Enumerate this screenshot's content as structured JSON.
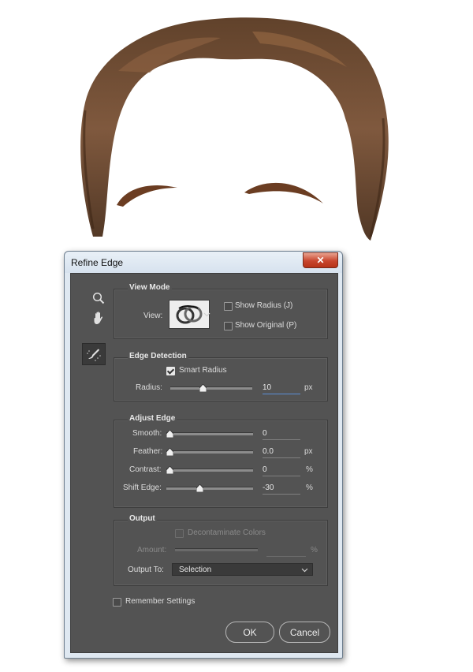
{
  "dialog": {
    "title": "Refine Edge",
    "close_glyph": "✕"
  },
  "view_mode": {
    "title": "View Mode",
    "view_label": "View:",
    "show_radius_label": "Show Radius (J)",
    "show_radius_checked": false,
    "show_original_label": "Show Original (P)",
    "show_original_checked": false
  },
  "edge_detection": {
    "title": "Edge Detection",
    "smart_radius_label": "Smart Radius",
    "smart_radius_checked": true,
    "radius_label": "Radius:",
    "radius_value": "10",
    "radius_unit": "px"
  },
  "adjust_edge": {
    "title": "Adjust Edge",
    "smooth_label": "Smooth:",
    "smooth_value": "0",
    "feather_label": "Feather:",
    "feather_value": "0.0",
    "feather_unit": "px",
    "contrast_label": "Contrast:",
    "contrast_value": "0",
    "contrast_unit": "%",
    "shift_edge_label": "Shift Edge:",
    "shift_edge_value": "-30",
    "shift_edge_unit": "%"
  },
  "output": {
    "title": "Output",
    "decontaminate_label": "Decontaminate Colors",
    "decontaminate_checked": false,
    "amount_label": "Amount:",
    "amount_value": "",
    "amount_unit": "%",
    "output_to_label": "Output To:",
    "output_to_value": "Selection"
  },
  "remember_settings_label": "Remember Settings",
  "remember_settings_checked": false,
  "buttons": {
    "ok": "OK",
    "cancel": "Cancel"
  },
  "icons": {
    "zoom": "zoom-icon",
    "hand": "hand-icon",
    "refine_radius": "refine-radius-brush-icon",
    "close": "close-icon",
    "chevron": "chevron-down-icon"
  },
  "colors": {
    "panel": "#535353",
    "dialog_frame": "#dfe8f1",
    "close_button": "#c8452d",
    "hair": "#6b4226"
  }
}
